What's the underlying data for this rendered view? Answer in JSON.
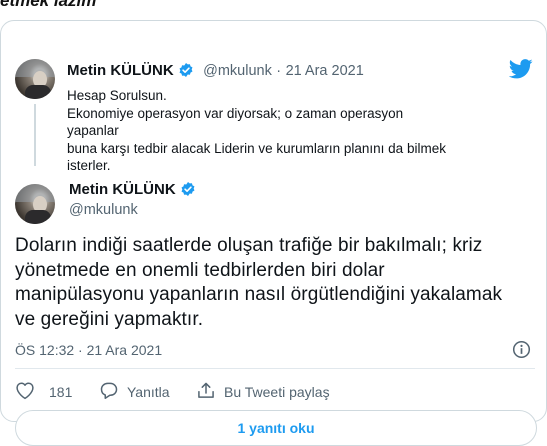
{
  "headline": "etmek lazım\"",
  "quoted_tweet": {
    "author_name": "Metin KÜLÜNK",
    "handle": "@mkulunk",
    "separator": "·",
    "date": "21 Ara 2021",
    "lines": [
      "Hesap Sorulsun.",
      "Ekonomiye operasyon var diyorsak; o zaman operasyon yapanlar",
      "buna karşı tedbir alacak Liderin ve kurumların planını da bilmek",
      "isterler."
    ]
  },
  "main_tweet": {
    "author_name": "Metin KÜLÜNK",
    "handle": "@mkulunk",
    "lines": [
      "Doların indiği saatlerde oluşan trafiğe bir bakılmalı; kriz",
      "yönetmede en onemli tedbirlerden biri dolar",
      "manipülasyonu yapanların nasıl örgütlendiğini yakalamak",
      "ve gereğini yapmaktır."
    ],
    "timestamp": "ÖS 12:32 · 21 Ara 2021"
  },
  "actions": {
    "like_count": "181",
    "reply_label": "Yanıtla",
    "share_label": "Bu Tweeti paylaş"
  },
  "read_replies_label": "1 yanıtı oku",
  "colors": {
    "twitter_blue": "#1d9bf0",
    "text": "#0f1419",
    "muted": "#536471",
    "border": "#cfd9de"
  },
  "icons": {
    "verified": "verified-badge-icon",
    "bird": "twitter-bird-icon",
    "info": "info-icon",
    "like": "heart-icon",
    "reply": "reply-bubble-icon",
    "share": "share-upload-icon"
  }
}
